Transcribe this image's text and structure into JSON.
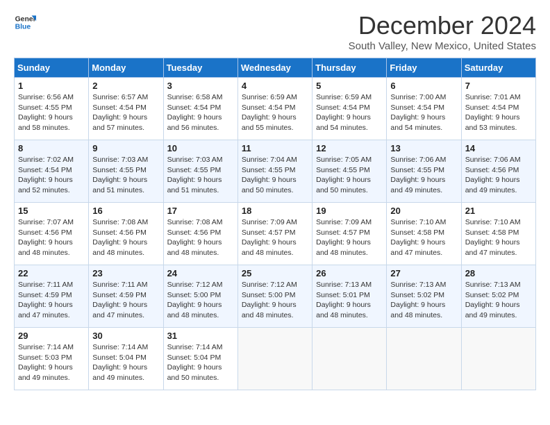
{
  "header": {
    "logo_line1": "General",
    "logo_line2": "Blue",
    "month": "December 2024",
    "location": "South Valley, New Mexico, United States"
  },
  "weekdays": [
    "Sunday",
    "Monday",
    "Tuesday",
    "Wednesday",
    "Thursday",
    "Friday",
    "Saturday"
  ],
  "weeks": [
    [
      {
        "day": "1",
        "info": "Sunrise: 6:56 AM\nSunset: 4:55 PM\nDaylight: 9 hours\nand 58 minutes."
      },
      {
        "day": "2",
        "info": "Sunrise: 6:57 AM\nSunset: 4:54 PM\nDaylight: 9 hours\nand 57 minutes."
      },
      {
        "day": "3",
        "info": "Sunrise: 6:58 AM\nSunset: 4:54 PM\nDaylight: 9 hours\nand 56 minutes."
      },
      {
        "day": "4",
        "info": "Sunrise: 6:59 AM\nSunset: 4:54 PM\nDaylight: 9 hours\nand 55 minutes."
      },
      {
        "day": "5",
        "info": "Sunrise: 6:59 AM\nSunset: 4:54 PM\nDaylight: 9 hours\nand 54 minutes."
      },
      {
        "day": "6",
        "info": "Sunrise: 7:00 AM\nSunset: 4:54 PM\nDaylight: 9 hours\nand 54 minutes."
      },
      {
        "day": "7",
        "info": "Sunrise: 7:01 AM\nSunset: 4:54 PM\nDaylight: 9 hours\nand 53 minutes."
      }
    ],
    [
      {
        "day": "8",
        "info": "Sunrise: 7:02 AM\nSunset: 4:54 PM\nDaylight: 9 hours\nand 52 minutes."
      },
      {
        "day": "9",
        "info": "Sunrise: 7:03 AM\nSunset: 4:55 PM\nDaylight: 9 hours\nand 51 minutes."
      },
      {
        "day": "10",
        "info": "Sunrise: 7:03 AM\nSunset: 4:55 PM\nDaylight: 9 hours\nand 51 minutes."
      },
      {
        "day": "11",
        "info": "Sunrise: 7:04 AM\nSunset: 4:55 PM\nDaylight: 9 hours\nand 50 minutes."
      },
      {
        "day": "12",
        "info": "Sunrise: 7:05 AM\nSunset: 4:55 PM\nDaylight: 9 hours\nand 50 minutes."
      },
      {
        "day": "13",
        "info": "Sunrise: 7:06 AM\nSunset: 4:55 PM\nDaylight: 9 hours\nand 49 minutes."
      },
      {
        "day": "14",
        "info": "Sunrise: 7:06 AM\nSunset: 4:56 PM\nDaylight: 9 hours\nand 49 minutes."
      }
    ],
    [
      {
        "day": "15",
        "info": "Sunrise: 7:07 AM\nSunset: 4:56 PM\nDaylight: 9 hours\nand 48 minutes."
      },
      {
        "day": "16",
        "info": "Sunrise: 7:08 AM\nSunset: 4:56 PM\nDaylight: 9 hours\nand 48 minutes."
      },
      {
        "day": "17",
        "info": "Sunrise: 7:08 AM\nSunset: 4:56 PM\nDaylight: 9 hours\nand 48 minutes."
      },
      {
        "day": "18",
        "info": "Sunrise: 7:09 AM\nSunset: 4:57 PM\nDaylight: 9 hours\nand 48 minutes."
      },
      {
        "day": "19",
        "info": "Sunrise: 7:09 AM\nSunset: 4:57 PM\nDaylight: 9 hours\nand 48 minutes."
      },
      {
        "day": "20",
        "info": "Sunrise: 7:10 AM\nSunset: 4:58 PM\nDaylight: 9 hours\nand 47 minutes."
      },
      {
        "day": "21",
        "info": "Sunrise: 7:10 AM\nSunset: 4:58 PM\nDaylight: 9 hours\nand 47 minutes."
      }
    ],
    [
      {
        "day": "22",
        "info": "Sunrise: 7:11 AM\nSunset: 4:59 PM\nDaylight: 9 hours\nand 47 minutes."
      },
      {
        "day": "23",
        "info": "Sunrise: 7:11 AM\nSunset: 4:59 PM\nDaylight: 9 hours\nand 47 minutes."
      },
      {
        "day": "24",
        "info": "Sunrise: 7:12 AM\nSunset: 5:00 PM\nDaylight: 9 hours\nand 48 minutes."
      },
      {
        "day": "25",
        "info": "Sunrise: 7:12 AM\nSunset: 5:00 PM\nDaylight: 9 hours\nand 48 minutes."
      },
      {
        "day": "26",
        "info": "Sunrise: 7:13 AM\nSunset: 5:01 PM\nDaylight: 9 hours\nand 48 minutes."
      },
      {
        "day": "27",
        "info": "Sunrise: 7:13 AM\nSunset: 5:02 PM\nDaylight: 9 hours\nand 48 minutes."
      },
      {
        "day": "28",
        "info": "Sunrise: 7:13 AM\nSunset: 5:02 PM\nDaylight: 9 hours\nand 49 minutes."
      }
    ],
    [
      {
        "day": "29",
        "info": "Sunrise: 7:14 AM\nSunset: 5:03 PM\nDaylight: 9 hours\nand 49 minutes."
      },
      {
        "day": "30",
        "info": "Sunrise: 7:14 AM\nSunset: 5:04 PM\nDaylight: 9 hours\nand 49 minutes."
      },
      {
        "day": "31",
        "info": "Sunrise: 7:14 AM\nSunset: 5:04 PM\nDaylight: 9 hours\nand 50 minutes."
      },
      {
        "day": "",
        "info": ""
      },
      {
        "day": "",
        "info": ""
      },
      {
        "day": "",
        "info": ""
      },
      {
        "day": "",
        "info": ""
      }
    ]
  ]
}
